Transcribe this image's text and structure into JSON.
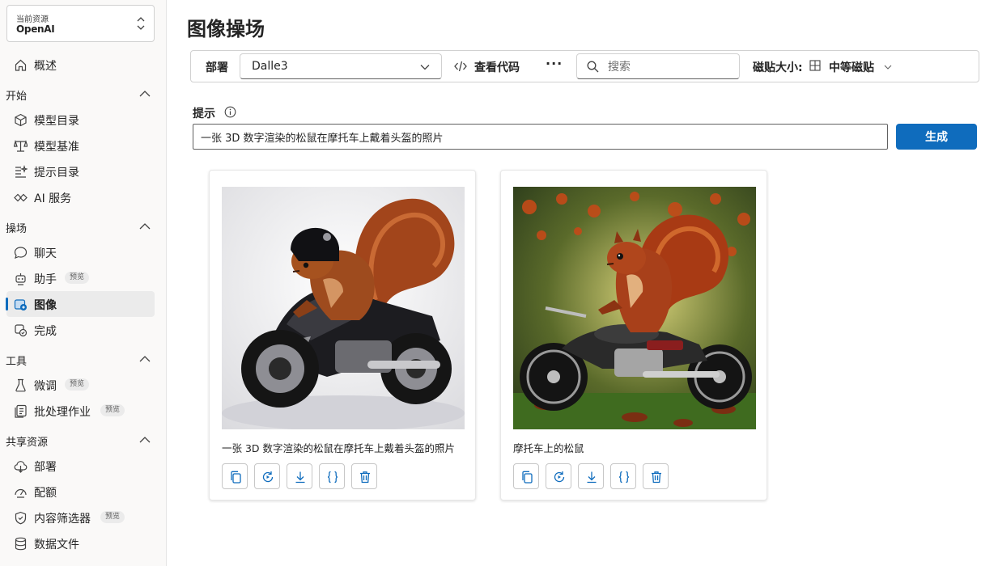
{
  "sidebar": {
    "resource_label": "当前资源",
    "resource_name": "OpenAI",
    "overview": "概述",
    "sections": {
      "start": "开始",
      "playground": "操场",
      "tools": "工具",
      "shared": "共享资源"
    },
    "items": {
      "model_catalog": "模型目录",
      "model_benchmark": "模型基准",
      "prompt_catalog": "提示目录",
      "ai_services": "AI 服务",
      "chat": "聊天",
      "assistant": "助手",
      "images": "图像",
      "completions": "完成",
      "finetune": "微调",
      "batch": "批处理作业",
      "deployments": "部署",
      "quota": "配额",
      "content_filters": "内容筛选器",
      "data_files": "数据文件"
    },
    "preview_badge": "预览"
  },
  "page_title": "图像操场",
  "toolbar": {
    "deployment_label": "部署",
    "deployment_value": "Dalle3",
    "view_code": "查看代码",
    "more": "···",
    "search_placeholder": "搜索",
    "tile_size_label": "磁贴大小:",
    "tile_size_value": "中等磁贴"
  },
  "prompt": {
    "label": "提示",
    "value": "一张 3D 数字渲染的松鼠在摩托车上戴着头盔的照片",
    "generate": "生成"
  },
  "cards": [
    {
      "caption": "一张 3D 数字渲染的松鼠在摩托车上戴着头盔的照片"
    },
    {
      "caption": "摩托车上的松鼠"
    }
  ],
  "colors": {
    "accent": "#0f6cbd"
  }
}
